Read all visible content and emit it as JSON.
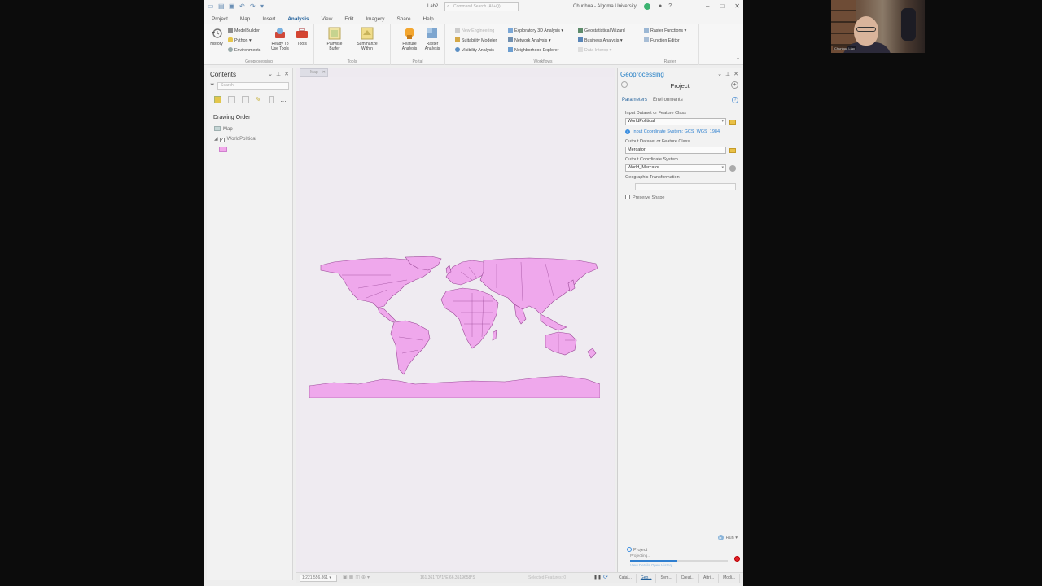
{
  "titlebar": {
    "doc_title": "Lab2",
    "search_placeholder": "Command Search (Alt+Q)",
    "user_name": "Chunhua - Algoma University",
    "user_initials": "CU"
  },
  "menu_tabs": [
    "Project",
    "Map",
    "Insert",
    "Analysis",
    "View",
    "Edit",
    "Imagery",
    "Share",
    "Help"
  ],
  "active_tab": "Analysis",
  "ribbon": {
    "geoprocessing": {
      "label": "Geoprocessing",
      "history": "History",
      "modelbuilder": "ModelBuilder",
      "python": "Python",
      "environments": "Environments",
      "ready_to_use": "Ready To Use Tools",
      "tools": "Tools"
    },
    "tools_group": {
      "label": "Tools",
      "pairwise_buffer": "Pairwise Buffer",
      "summarize_within": "Summarize Within"
    },
    "portal": {
      "label": "Portal",
      "feature_analysis": "Feature Analysis",
      "raster_analysis": "Raster Analysis"
    },
    "workflows": {
      "label": "Workflows",
      "new_engineering": "New Engineering",
      "suitability_modeler": "Suitability Modeler",
      "visibility_analysis": "Visibility Analysis",
      "exploratory_3d": "Exploratory 3D Analysis",
      "network_analysis": "Network Analysis",
      "neighborhood_explorer": "Neighborhood Explorer",
      "geostatistical_wizard": "Geostatistical Wizard",
      "business_analysis": "Business Analysis",
      "data_interop": "Data Interop"
    },
    "raster": {
      "label": "Raster",
      "raster_functions": "Raster Functions",
      "function_editor": "Function Editor"
    }
  },
  "contents": {
    "title": "Contents",
    "search_placeholder": "Search",
    "drawing_order": "Drawing Order",
    "map_node": "Map",
    "layer_name": "WorldPolitical",
    "layer_color": "#f1a8ea"
  },
  "map": {
    "tab_label": "Map",
    "fill_color": "#efa8ec",
    "outline_color": "#9b4a98"
  },
  "statusbar": {
    "scale": "1:221,556,861",
    "coordinates": "161.3617071°E 66.3519658°S",
    "selected_features": "Selected Features: 0",
    "bottom_tabs": [
      "Catal...",
      "Geo...",
      "Sym...",
      "Creat...",
      "Attri...",
      "Modi..."
    ],
    "active_bottom_tab": 1
  },
  "geoprocessing": {
    "title": "Geoprocessing",
    "tool_name": "Project",
    "tab_parameters": "Parameters",
    "tab_environments": "Environments",
    "input_label": "Input Dataset or Feature Class",
    "input_value": "WorldPolitical",
    "input_cs": "Input Coordinate System: GCS_WGS_1984",
    "output_label": "Output Dataset or Feature Class",
    "output_value": "Mercator",
    "ocs_label": "Output Coordinate System",
    "ocs_value": "World_Mercator",
    "geo_trans_label": "Geographic Transformation",
    "preserve_label": "Preserve Shape",
    "run_label": "Run",
    "progress_tool": "Project",
    "progress_message": "Projecting...",
    "progress": 0.48,
    "progress_links": "View Details   Open History"
  },
  "webcam": {
    "name_tag": "Chunhua Liao"
  }
}
